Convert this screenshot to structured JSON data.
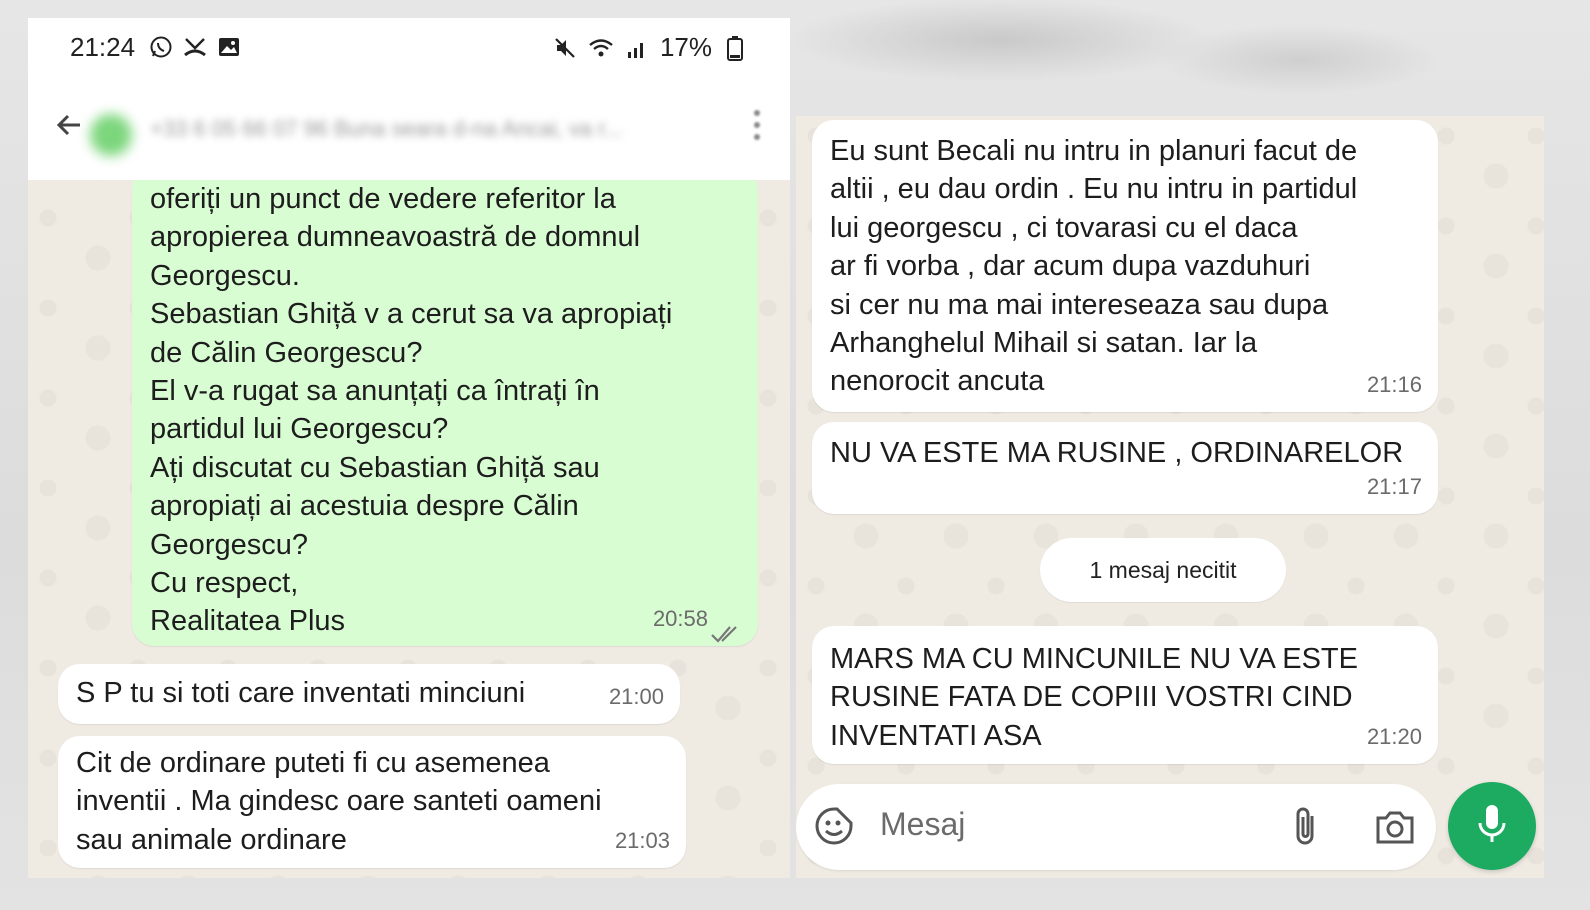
{
  "status_bar": {
    "time": "21:24",
    "battery": "17%",
    "left_icons": [
      "whatsapp-icon",
      "missed-call-icon",
      "gallery-icon"
    ],
    "right_icons": [
      "mute-icon",
      "wifi-icon",
      "signal-icon",
      "battery-icon"
    ]
  },
  "header": {
    "contact_name": "+33 6 05 66 07 96 Buna seara d-na Ancai, va r..."
  },
  "left_chat": {
    "sent": {
      "lines": [
        "oferiți un punct de vedere referitor la",
        "apropierea dumneavoastră de domnul",
        "Georgescu.",
        "Sebastian Ghiță v a cerut sa va apropiați",
        "de Călin Georgescu?",
        "El v-a rugat sa anunțați ca întrați în",
        "partidul lui Georgescu?",
        "Ați discutat cu Sebastian Ghiță sau",
        "apropiați ai acestuia despre Călin",
        "Georgescu?",
        "Cu respect,",
        "Realitatea Plus"
      ],
      "time": "20:58",
      "status": "read"
    },
    "reply_1": {
      "lines": [
        "S P tu si toti care inventati minciuni"
      ],
      "time": "21:00"
    },
    "reply_2": {
      "lines": [
        "Cit de ordinare puteti fi cu asemenea",
        "inventii . Ma gindesc oare santeti oameni",
        "sau animale ordinare"
      ],
      "time": "21:03"
    }
  },
  "right_chat": {
    "msg_1": {
      "lines": [
        "Eu sunt Becali nu intru in planuri facut de",
        "altii , eu dau ordin . Eu nu intru in partidul",
        "lui georgescu , ci tovarasi cu el daca",
        "ar fi vorba , dar acum dupa vazduhuri",
        "si cer nu ma mai intereseaza sau dupa",
        "Arhanghelul Mihail si satan. Iar la",
        "nenorocit ancuta"
      ],
      "time": "21:16"
    },
    "msg_2": {
      "lines": [
        "NU VA ESTE MA RUSINE , ORDINARELOR"
      ],
      "time": "21:17"
    },
    "unread_label": "1 mesaj necitit",
    "msg_3": {
      "lines": [
        "MARS MA CU MINCUNILE NU VA ESTE",
        "RUSINE FATA DE COPIII VOSTRI CIND",
        "INVENTATI ASA"
      ],
      "time": "21:20"
    },
    "input": {
      "placeholder": "Mesaj"
    }
  },
  "colors": {
    "outgoing_bubble": "#d9fdd3",
    "incoming_bubble": "#ffffff",
    "chat_background": "#efeae2",
    "mic_button": "#1daa61"
  }
}
